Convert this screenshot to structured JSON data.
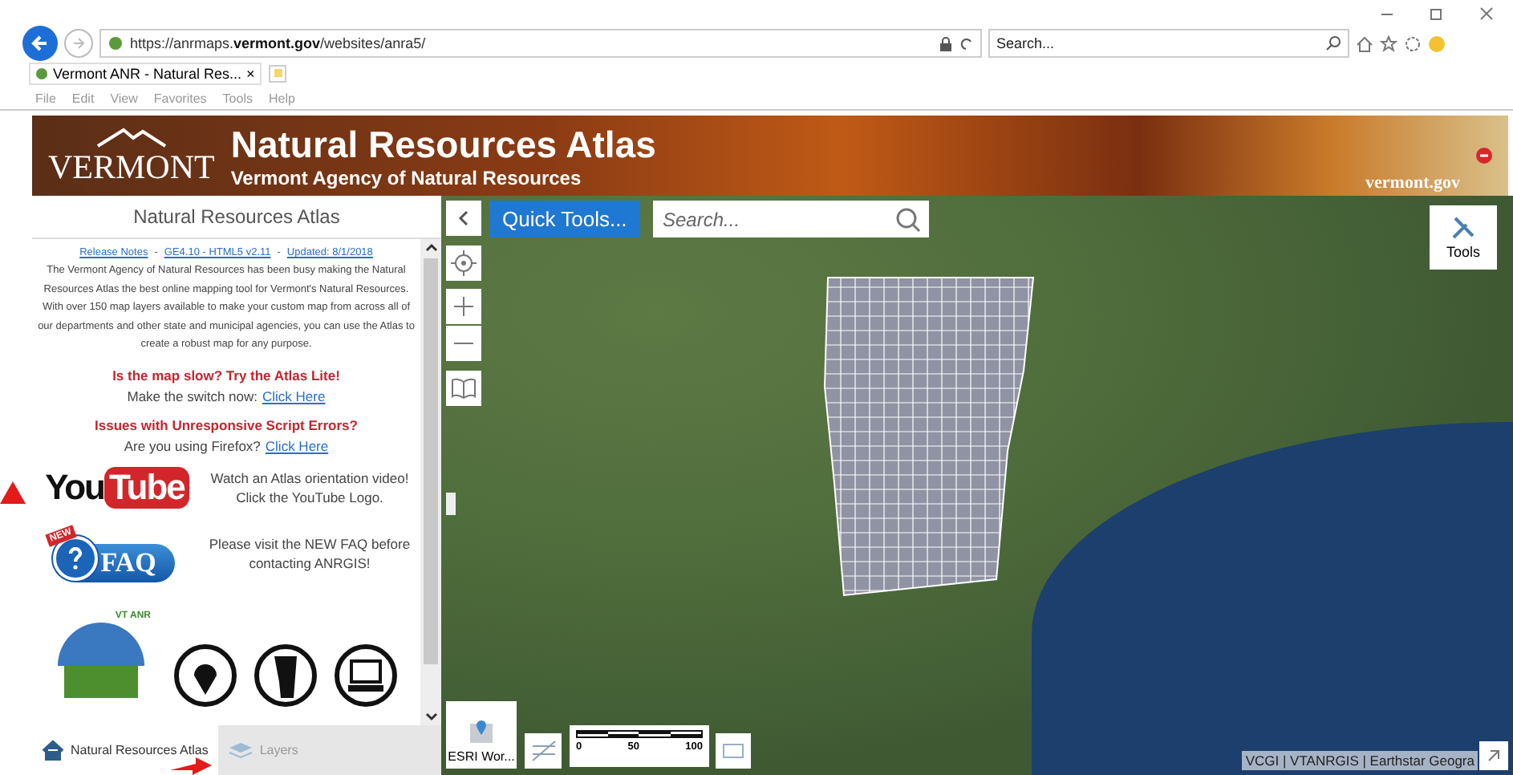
{
  "browser": {
    "url": "https://anrmaps.**vermont.gov**/websites/anra5/",
    "search_placeholder": "Search...",
    "tab_title": "Vermont ANR - Natural Res...",
    "tab_close": "×",
    "menu": [
      "File",
      "Edit",
      "View",
      "Favorites",
      "Tools",
      "Help"
    ]
  },
  "banner": {
    "state": "VERMONT",
    "title": "Natural Resources Atlas",
    "subtitle": "Vermont Agency of Natural Resources",
    "site": "vermont.gov"
  },
  "panel": {
    "title": "Natural Resources Atlas",
    "links": [
      "Release Notes",
      "GE4.10 - HTML5 v2.11",
      "Updated: 8/1/2018"
    ],
    "separator": "-",
    "intro": "The Vermont Agency of Natural Resources has been busy making the Natural Resources Atlas the best online mapping tool for Vermont's Natural Resources. With over 150 map layers available to make your custom map from across all of our departments and other state and municipal agencies, you can use the Atlas to create a robust map for any purpose.",
    "notices": [
      {
        "heading": "Is the map slow? Try the Atlas Lite!",
        "prompt": "Make the switch now:",
        "link": "Click Here"
      },
      {
        "heading": "Issues with Unresponsive Script Errors?",
        "prompt": "Are you using Firefox?",
        "link": "Click Here"
      }
    ],
    "promos": [
      {
        "kind": "youtube",
        "logo": [
          "You",
          "Tube"
        ],
        "text": "Watch an Atlas orientation video! Click the YouTube Logo."
      },
      {
        "kind": "faq",
        "logo": [
          "NEW",
          "FAQ"
        ],
        "text": "Please visit the NEW FAQ before contacting ANRGIS!"
      }
    ],
    "anr_logo": "VT ANR",
    "tabs": [
      {
        "label": "Natural Resources Atlas",
        "selected": true
      },
      {
        "label": "Layers",
        "selected": false
      }
    ]
  },
  "map": {
    "quick_tools": "Quick Tools...",
    "search_placeholder": "Search...",
    "tools": "Tools",
    "basemap": "ESRI Wor...",
    "scale": [
      "0",
      "50",
      "100"
    ],
    "attribution": "VCGI | VTANRGIS | Earthstar Geogra"
  }
}
